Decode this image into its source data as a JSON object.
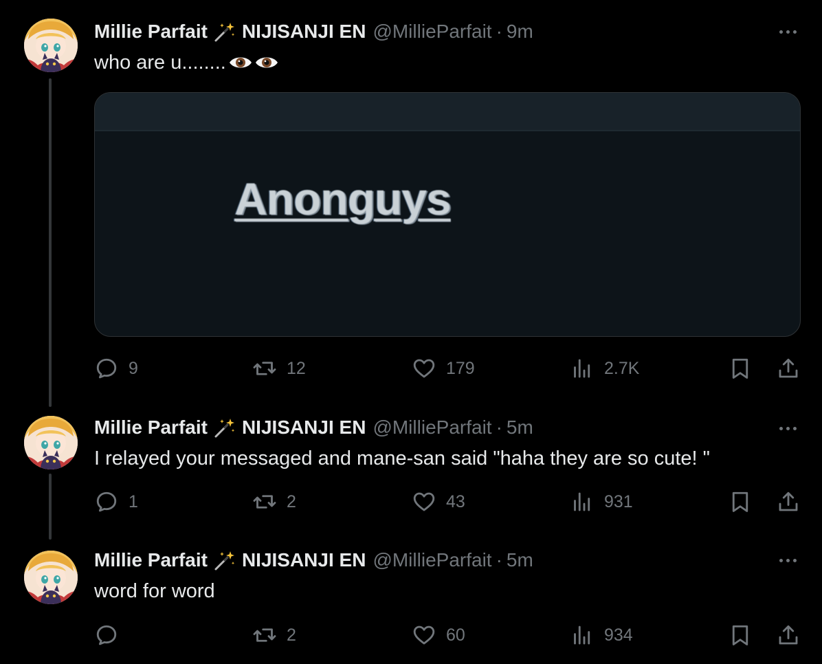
{
  "tweets": [
    {
      "display_name": "Millie Parfait",
      "affiliation": "NIJISANJI EN",
      "handle": "@MillieParfait",
      "separator": "·",
      "time": "9m",
      "text": "who are u........",
      "media_text": "Anonguys",
      "stats": {
        "replies": "9",
        "retweets": "12",
        "likes": "179",
        "views": "2.7K"
      }
    },
    {
      "display_name": "Millie Parfait",
      "affiliation": "NIJISANJI EN",
      "handle": "@MillieParfait",
      "separator": "·",
      "time": "5m",
      "text": "I relayed your messaged and mane-san said \"haha they are so cute! \"",
      "stats": {
        "replies": "1",
        "retweets": "2",
        "likes": "43",
        "views": "931"
      }
    },
    {
      "display_name": "Millie Parfait",
      "affiliation": "NIJISANJI EN",
      "handle": "@MillieParfait",
      "separator": "·",
      "time": "5m",
      "text": "word for word",
      "stats": {
        "replies": "",
        "retweets": "2",
        "likes": "60",
        "views": "934"
      }
    }
  ],
  "icons": {
    "badge": "magic-wand-icon",
    "emoji": "eyes-icon",
    "more": "more-icon",
    "reply": "reply-icon",
    "retweet": "retweet-icon",
    "like": "heart-icon",
    "views": "views-icon",
    "bookmark": "bookmark-icon",
    "share": "share-icon"
  },
  "colors": {
    "background": "#000000",
    "primary_text": "#e7e9ea",
    "secondary_text": "#71767b",
    "thread_line": "#333639",
    "border": "#2f3336"
  }
}
